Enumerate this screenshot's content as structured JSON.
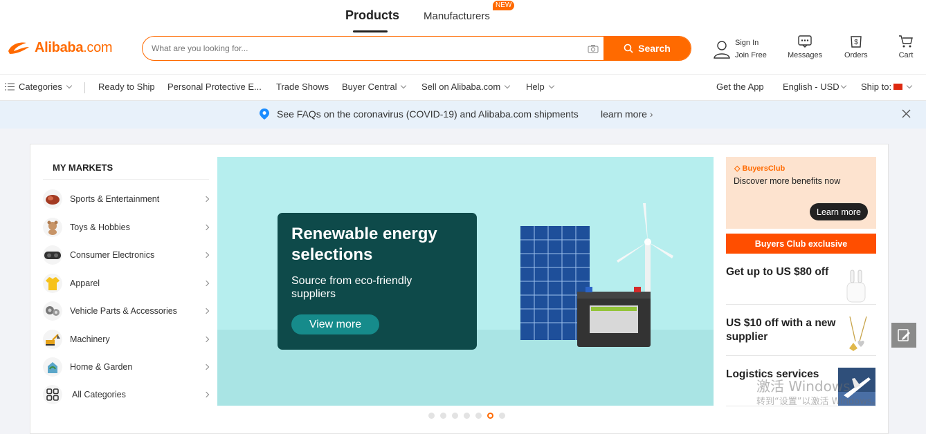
{
  "header": {
    "tab_products": "Products",
    "tab_manufacturers": "Manufacturers",
    "new_badge": "NEW",
    "logo_text": "Alibaba",
    "logo_suffix": ".com",
    "search_placeholder": "What are you looking for...",
    "search_button": "Search",
    "sign_in": "Sign In",
    "join_free": "Join Free",
    "messages": "Messages",
    "orders": "Orders",
    "cart": "Cart",
    "brand_color": "#ff6a00"
  },
  "nav": {
    "categories": "Categories",
    "ready_to_ship": "Ready to Ship",
    "ppe": "Personal Protective E...",
    "trade_shows": "Trade Shows",
    "buyer_central": "Buyer Central",
    "sell": "Sell on Alibaba.com",
    "help": "Help",
    "get_app": "Get the App",
    "language": "English - USD",
    "ship_to": "Ship to:"
  },
  "notice": {
    "message": "See FAQs on the coronavirus (COVID-19) and Alibaba.com shipments",
    "learn_more": "learn more"
  },
  "markets": {
    "title": "MY MARKETS",
    "items": [
      {
        "label": "Sports & Entertainment",
        "icon": "sports-icon"
      },
      {
        "label": "Toys & Hobbies",
        "icon": "toys-icon"
      },
      {
        "label": "Consumer Electronics",
        "icon": "electronics-icon"
      },
      {
        "label": "Apparel",
        "icon": "apparel-icon"
      },
      {
        "label": "Vehicle Parts & Accessories",
        "icon": "vehicle-parts-icon"
      },
      {
        "label": "Machinery",
        "icon": "machinery-icon"
      },
      {
        "label": "Home & Garden",
        "icon": "home-garden-icon"
      },
      {
        "label": "All Categories",
        "icon": "all-categories-icon"
      }
    ]
  },
  "banner": {
    "title": "Renewable energy selections",
    "subtitle": "Source from eco-friendly suppliers",
    "button": "View more",
    "slide_count": 7,
    "active_slide": 6
  },
  "buyers_club": {
    "logo": "BuyersClub",
    "text": "Discover more benefits now",
    "button": "Learn more",
    "exclusive": "Buyers Club exclusive"
  },
  "offers": [
    {
      "text": "Get up to US $80 off"
    },
    {
      "text": "US $10 off with a new supplier"
    },
    {
      "text": "Logistics services"
    }
  ],
  "watermark": {
    "line1": "激活 Windows",
    "line2": "转到“设置”以激活 Windows。"
  }
}
